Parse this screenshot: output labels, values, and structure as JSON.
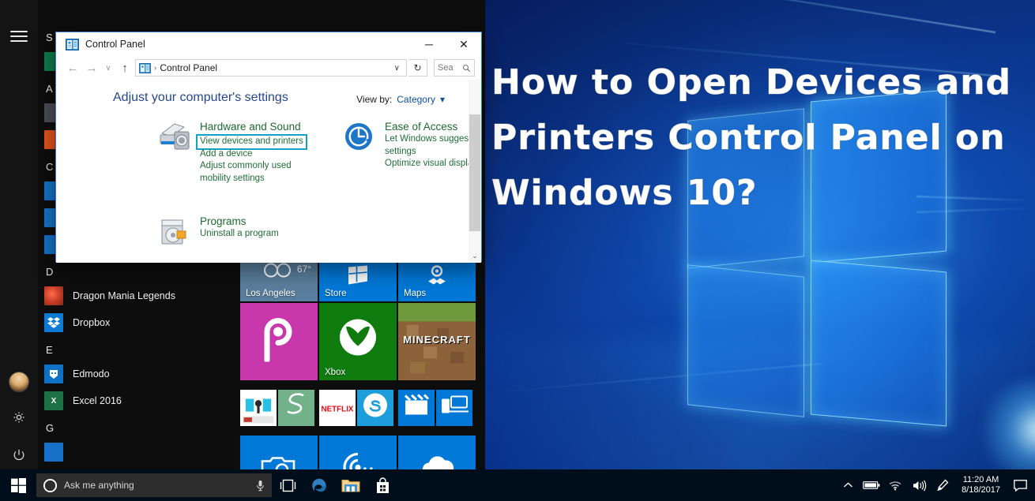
{
  "overlay": {
    "title": "How to Open Devices and Printers Control Panel on Windows 10?"
  },
  "control_panel": {
    "window_title": "Control Panel",
    "title_icon": "control-panel-icon",
    "minimize_label": "─",
    "close_label": "✕",
    "nav": {
      "back": "←",
      "forward": "→",
      "recent": "∨",
      "up": "↑",
      "breadcrumb_icon": "control-panel-icon",
      "breadcrumb_sep": "›",
      "breadcrumb": "Control Panel",
      "dropdown": "∨",
      "refresh": "↻",
      "search_value": "Sea",
      "search_icon": "search-icon"
    },
    "heading": "Adjust your computer's settings",
    "view_by_label": "View by:",
    "view_by_value": "Category",
    "view_by_caret": "▾",
    "categories": [
      {
        "icon": "printer-icon",
        "title": "Hardware and Sound",
        "links": [
          "View devices and printers",
          "Add a device",
          "Adjust commonly used mobility settings"
        ],
        "highlighted_link": "View devices and printers"
      },
      {
        "icon": "ease-of-access-icon",
        "title": "Ease of Access",
        "links": [
          "Let Windows suggest settings",
          "Optimize visual display"
        ]
      },
      {
        "icon": "programs-icon",
        "title": "Programs",
        "links": [
          "Uninstall a program"
        ]
      }
    ],
    "scrollbar_down": "⌄"
  },
  "start_menu": {
    "rail": [
      {
        "name": "hamburger-icon",
        "label": "Menu"
      },
      {
        "name": "avatar",
        "label": "User"
      },
      {
        "name": "gear-icon",
        "label": "Settings"
      },
      {
        "name": "power-icon",
        "label": "Power"
      }
    ],
    "groups": [
      {
        "letter": "S",
        "apps": [
          {
            "name": "",
            "color": "#0f7a4a"
          }
        ]
      },
      {
        "letter": "A",
        "apps": [
          {
            "name": "",
            "color": "#4b4b55"
          },
          {
            "name": "",
            "color": "#e2541e"
          }
        ]
      },
      {
        "letter": "C",
        "apps": [
          {
            "name": "",
            "color": "#1572c8"
          },
          {
            "name": "",
            "color": "#1572c8"
          },
          {
            "name": "",
            "color": "#1572c8"
          }
        ]
      },
      {
        "letter": "D",
        "apps": [
          {
            "name": "Dragon Mania Legends",
            "color": "#c23a25"
          },
          {
            "name": "Dropbox",
            "color": "#0d7ad6"
          }
        ]
      },
      {
        "letter": "E",
        "apps": [
          {
            "name": "Edmodo",
            "color": "#1072c6"
          },
          {
            "name": "Excel 2016",
            "color": "#1d7044"
          }
        ]
      },
      {
        "letter": "G",
        "apps": [
          {
            "name": "",
            "color": "#1572c8"
          }
        ]
      }
    ],
    "tiles": [
      {
        "label": "Los Angeles",
        "sub": "67°",
        "icon": "weather-cloud-icon",
        "color": "#5a7f9e"
      },
      {
        "label": "Store",
        "icon": "store-icon",
        "color": "#0078d7"
      },
      {
        "label": "Maps",
        "icon": "maps-pin-icon",
        "color": "#0078d7"
      },
      {
        "label": "",
        "icon": "picsart-icon",
        "color": "#c837ab"
      },
      {
        "label": "Xbox",
        "icon": "xbox-icon",
        "color": "#107c10"
      },
      {
        "label": "",
        "icon": "minecraft-icon",
        "color": "#8b6239"
      },
      {
        "label": "",
        "icon": "education-icon",
        "color": "#ffffff"
      },
      {
        "label": "",
        "icon": "sway-icon",
        "color": "#72b18a"
      },
      {
        "label": "",
        "icon": "netflix-icon",
        "color": "#ffffff"
      },
      {
        "label": "",
        "icon": "skype-icon",
        "color": "#1e9ddb"
      },
      {
        "label": "",
        "icon": "movies-tv-icon",
        "color": "#0078d7"
      },
      {
        "label": "",
        "icon": "connect-icon",
        "color": "#0078d7"
      },
      {
        "label": "",
        "icon": "camera-icon",
        "color": "#0078d7"
      },
      {
        "label": "",
        "icon": "groove-music-icon",
        "color": "#0078d7"
      },
      {
        "label": "",
        "icon": "onedrive-icon",
        "color": "#0078d7"
      }
    ]
  },
  "taskbar": {
    "start_icon": "windows-start-icon",
    "cortana": {
      "ring_icon": "cortana-ring-icon",
      "placeholder": "Ask me anything",
      "mic_icon": "microphone-icon"
    },
    "pinned": [
      {
        "name": "task-view-icon"
      },
      {
        "name": "edge-icon"
      },
      {
        "name": "file-explorer-icon"
      },
      {
        "name": "store-icon"
      }
    ],
    "tray": [
      {
        "name": "show-hidden-icons-icon",
        "glyph": "∧"
      },
      {
        "name": "battery-icon",
        "glyph": ""
      },
      {
        "name": "wifi-icon",
        "glyph": ""
      },
      {
        "name": "volume-icon",
        "glyph": ""
      },
      {
        "name": "pen-workspace-icon",
        "glyph": ""
      }
    ],
    "clock_time": "11:20 AM",
    "clock_date": "8/18/2017",
    "action_center_icon": "action-center-icon"
  },
  "colors": {
    "accent": "#0078d7",
    "highlight": "#12a2c4",
    "cp_heading": "#26478d",
    "cp_link": "#1f6d3a"
  }
}
